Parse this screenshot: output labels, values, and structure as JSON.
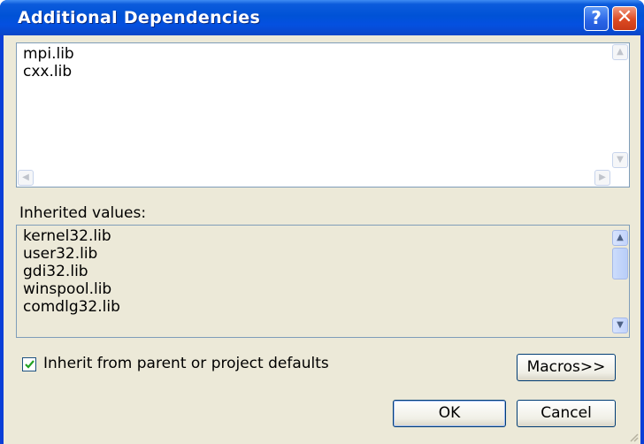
{
  "window": {
    "title": "Additional Dependencies",
    "help_glyph": "?",
    "close_glyph": "✕"
  },
  "dependencies": {
    "lines": [
      "mpi.lib",
      "cxx.lib"
    ]
  },
  "inherited": {
    "label": "Inherited values:",
    "lines": [
      "kernel32.lib",
      "user32.lib",
      "gdi32.lib",
      "winspool.lib",
      "comdlg32.lib"
    ]
  },
  "inherit_checkbox": {
    "label": "Inherit from parent or project defaults",
    "checked": true
  },
  "buttons": {
    "macros": "Macros>>",
    "ok": "OK",
    "cancel": "Cancel"
  },
  "colors": {
    "titlebar": "#0052d6",
    "client": "#ece9d8",
    "border_blue": "#7f9db9"
  }
}
